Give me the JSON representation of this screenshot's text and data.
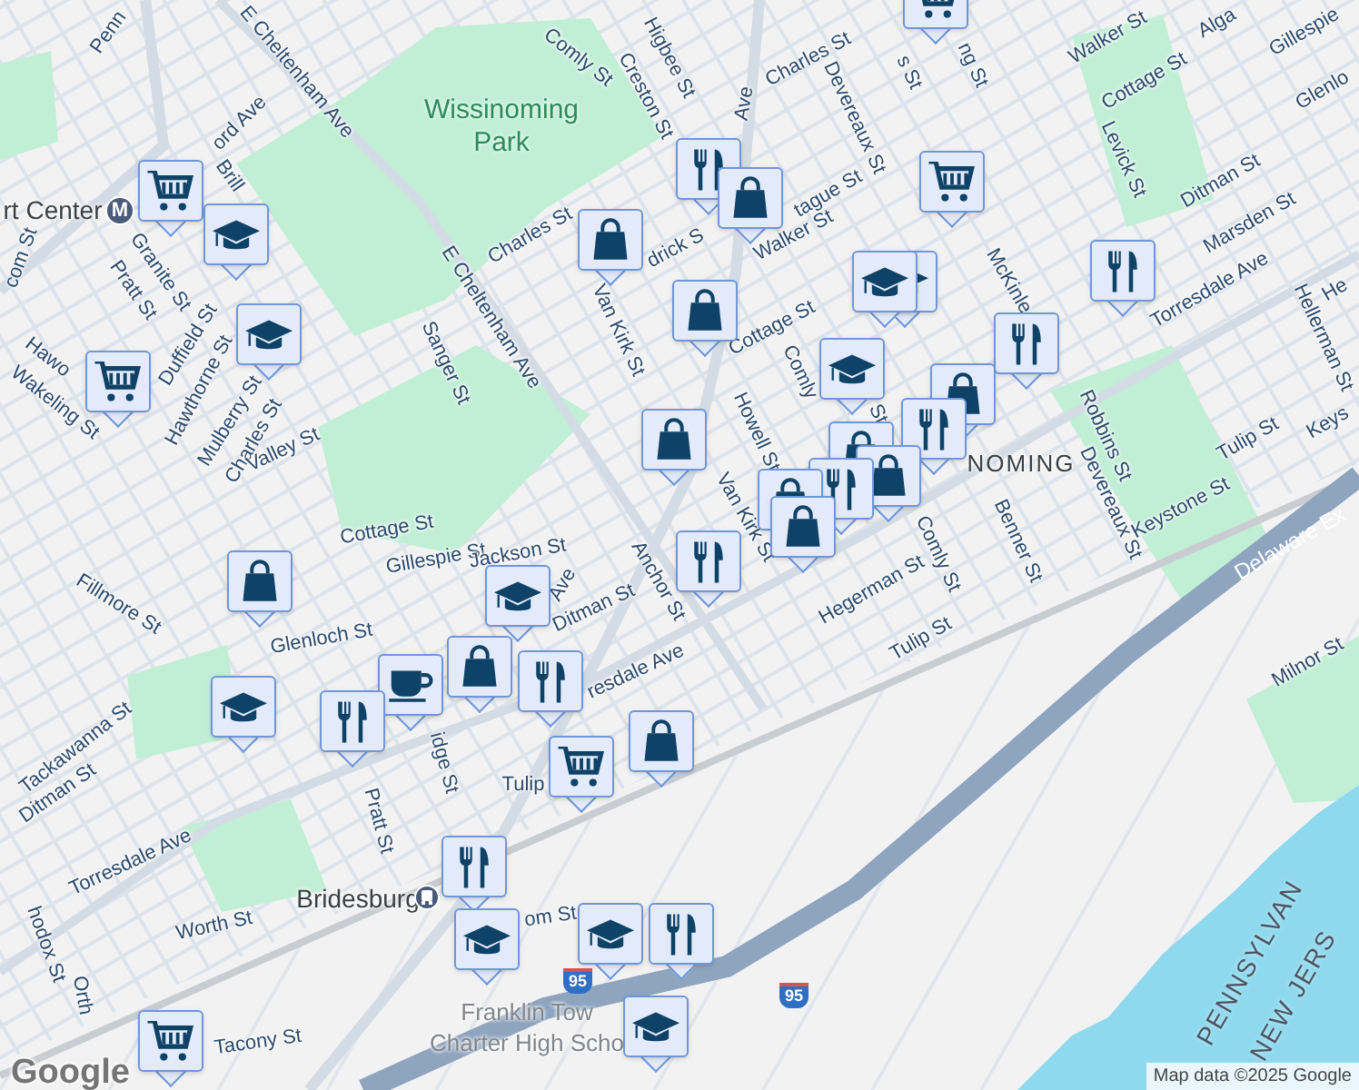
{
  "map": {
    "labels": [
      {
        "text": "Penn",
        "kind": "street"
      },
      {
        "text": "E Cheltenham Ave",
        "kind": "street"
      },
      {
        "text": "Wissinoming Park",
        "kind": "park"
      },
      {
        "text": "Comly St",
        "kind": "street"
      },
      {
        "text": "Higbee St",
        "kind": "street"
      },
      {
        "text": "Creston St",
        "kind": "street"
      },
      {
        "text": "Charles St",
        "kind": "street"
      },
      {
        "text": "Ave",
        "kind": "street"
      },
      {
        "text": "ord Ave",
        "kind": "street"
      },
      {
        "text": "Devereaux St",
        "kind": "street"
      },
      {
        "text": "Brill",
        "kind": "street"
      },
      {
        "text": "rt Center",
        "kind": "place"
      },
      {
        "text": "Charles St",
        "kind": "street"
      },
      {
        "text": "drick S",
        "kind": "street"
      },
      {
        "text": "tague St",
        "kind": "street"
      },
      {
        "text": "Walker St",
        "kind": "street"
      },
      {
        "text": "com St",
        "kind": "street"
      },
      {
        "text": "Granite St",
        "kind": "street"
      },
      {
        "text": "Pratt St",
        "kind": "street"
      },
      {
        "text": "Van Kirk St",
        "kind": "street"
      },
      {
        "text": "Duffield St",
        "kind": "street"
      },
      {
        "text": "Sanger St",
        "kind": "street"
      },
      {
        "text": "E Cheltenham Ave",
        "kind": "street"
      },
      {
        "text": "Hawo",
        "kind": "street"
      },
      {
        "text": "Wakeling St",
        "kind": "street"
      },
      {
        "text": "Hawthorne St",
        "kind": "street"
      },
      {
        "text": "Mulberry St",
        "kind": "street"
      },
      {
        "text": "Charles St",
        "kind": "street"
      },
      {
        "text": "Valley St",
        "kind": "street"
      },
      {
        "text": "Cottage St",
        "kind": "street"
      },
      {
        "text": "Comly",
        "kind": "street"
      },
      {
        "text": "Howell St",
        "kind": "street"
      },
      {
        "text": "St",
        "kind": "street"
      },
      {
        "text": "NOMING",
        "kind": "district"
      },
      {
        "text": "Van Kirk St",
        "kind": "street"
      },
      {
        "text": "s St",
        "kind": "street"
      },
      {
        "text": "ng St",
        "kind": "street"
      },
      {
        "text": "Walker St",
        "kind": "street"
      },
      {
        "text": "Alga",
        "kind": "street"
      },
      {
        "text": "Gillespie",
        "kind": "street"
      },
      {
        "text": "Cottage St",
        "kind": "street"
      },
      {
        "text": "Glenlo",
        "kind": "street"
      },
      {
        "text": "Levick St",
        "kind": "street"
      },
      {
        "text": "Ditman St",
        "kind": "street"
      },
      {
        "text": "Marsden St",
        "kind": "street"
      },
      {
        "text": "Torresdale Ave",
        "kind": "street"
      },
      {
        "text": "He",
        "kind": "street"
      },
      {
        "text": "Hellerman St",
        "kind": "street"
      },
      {
        "text": "McKinle",
        "kind": "street"
      },
      {
        "text": "Robbins St",
        "kind": "street"
      },
      {
        "text": "Tulip St",
        "kind": "street"
      },
      {
        "text": "Keys",
        "kind": "street"
      },
      {
        "text": "Devereaux St",
        "kind": "street"
      },
      {
        "text": "Keystone St",
        "kind": "street"
      },
      {
        "text": "Benner St",
        "kind": "street"
      },
      {
        "text": "Delaware Ex",
        "kind": "highway"
      },
      {
        "text": "Cottage St",
        "kind": "street"
      },
      {
        "text": "Gillespie St",
        "kind": "street"
      },
      {
        "text": "Jackson St",
        "kind": "street"
      },
      {
        "text": "Ave",
        "kind": "street"
      },
      {
        "text": "Anchor St",
        "kind": "street"
      },
      {
        "text": "Comly St",
        "kind": "street"
      },
      {
        "text": "Fillmore St",
        "kind": "street"
      },
      {
        "text": "Hegerman St",
        "kind": "street"
      },
      {
        "text": "Glenloch St",
        "kind": "street"
      },
      {
        "text": "Ditman St",
        "kind": "street"
      },
      {
        "text": "Tulip St",
        "kind": "street"
      },
      {
        "text": "Milnor St",
        "kind": "street"
      },
      {
        "text": "resdale Ave",
        "kind": "street"
      },
      {
        "text": "Tackawanna St",
        "kind": "street"
      },
      {
        "text": "Tulip",
        "kind": "street"
      },
      {
        "text": "Ditman St",
        "kind": "street"
      },
      {
        "text": "idge St",
        "kind": "street"
      },
      {
        "text": "Pratt St",
        "kind": "street"
      },
      {
        "text": "Torresdale Ave",
        "kind": "street"
      },
      {
        "text": "hodox St",
        "kind": "street"
      },
      {
        "text": "Bridesburg",
        "kind": "place"
      },
      {
        "text": "Worth St",
        "kind": "street"
      },
      {
        "text": "om St",
        "kind": "street"
      },
      {
        "text": "Orth",
        "kind": "street"
      },
      {
        "text": "Tacony St",
        "kind": "street"
      },
      {
        "text": "Franklin Tow",
        "kind": "poi"
      },
      {
        "text": "Charter High Scho",
        "kind": "poi"
      },
      {
        "text": "PENNSYLVAN",
        "kind": "state"
      },
      {
        "text": "NEW JERS",
        "kind": "state"
      }
    ],
    "stations": [
      {
        "kind": "metro",
        "text": "M"
      },
      {
        "kind": "train"
      }
    ],
    "shields": [
      {
        "text": "95"
      },
      {
        "text": "95"
      }
    ],
    "markers": [
      {
        "kind": "cart"
      },
      {
        "kind": "food"
      },
      {
        "kind": "bag"
      },
      {
        "kind": "cart"
      },
      {
        "kind": "cart"
      },
      {
        "kind": "school"
      },
      {
        "kind": "bag"
      },
      {
        "kind": "school"
      },
      {
        "kind": "school"
      },
      {
        "kind": "food"
      },
      {
        "kind": "bag"
      },
      {
        "kind": "school"
      },
      {
        "kind": "food"
      },
      {
        "kind": "school"
      },
      {
        "kind": "cart"
      },
      {
        "kind": "bag"
      },
      {
        "kind": "food"
      },
      {
        "kind": "bag"
      },
      {
        "kind": "bag"
      },
      {
        "kind": "bag"
      },
      {
        "kind": "food"
      },
      {
        "kind": "bag"
      },
      {
        "kind": "bag"
      },
      {
        "kind": "food"
      },
      {
        "kind": "bag"
      },
      {
        "kind": "school"
      },
      {
        "kind": "bag"
      },
      {
        "kind": "coffee"
      },
      {
        "kind": "food"
      },
      {
        "kind": "school"
      },
      {
        "kind": "food"
      },
      {
        "kind": "bag"
      },
      {
        "kind": "cart"
      },
      {
        "kind": "food"
      },
      {
        "kind": "school"
      },
      {
        "kind": "school"
      },
      {
        "kind": "food"
      },
      {
        "kind": "school"
      },
      {
        "kind": "cart"
      }
    ],
    "logo": "Google",
    "attribution": "Map data ©2025 Google"
  }
}
